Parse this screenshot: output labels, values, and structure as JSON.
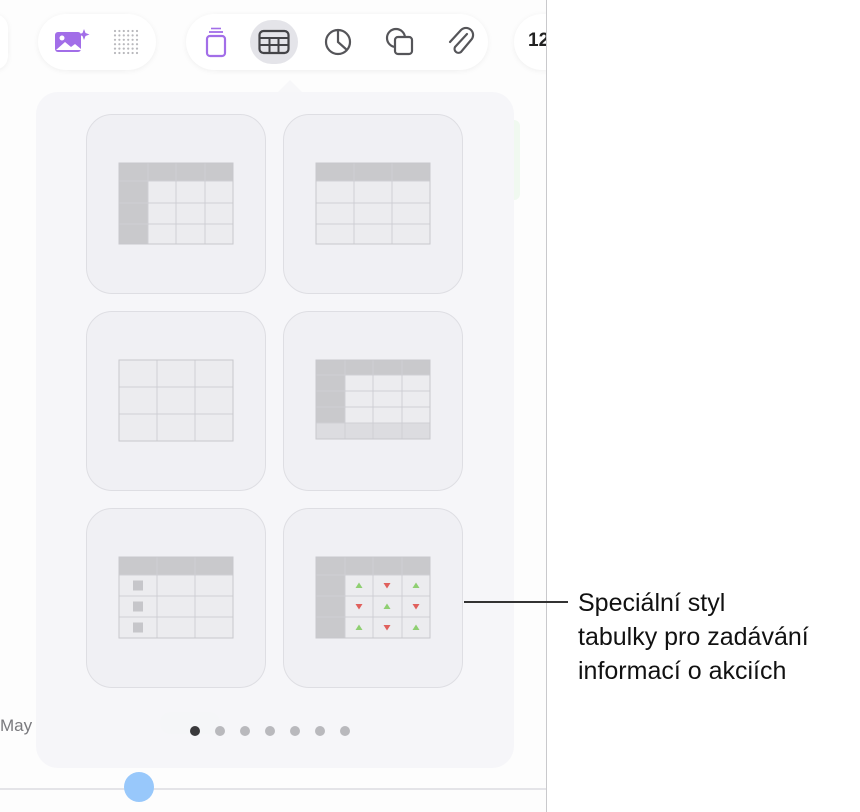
{
  "toolbar": {
    "buttons": [
      {
        "name": "media-button",
        "icon": "photo-sparkle-icon",
        "active": false
      },
      {
        "name": "grid-button",
        "icon": "dotted-grid-icon",
        "active": false
      },
      {
        "name": "text-box-button",
        "icon": "text-box-icon",
        "active": false
      },
      {
        "name": "table-button",
        "icon": "table-icon",
        "active": true
      },
      {
        "name": "chart-button",
        "icon": "pie-chart-icon",
        "active": false
      },
      {
        "name": "shape-button",
        "icon": "shape-icon",
        "active": false
      },
      {
        "name": "attachment-button",
        "icon": "paperclip-icon",
        "active": false
      }
    ],
    "partial_right_text": "12"
  },
  "table_styles": {
    "tiles": [
      {
        "style": "header-row-and-column"
      },
      {
        "style": "header-row"
      },
      {
        "style": "plain"
      },
      {
        "style": "header-row-column-footer"
      },
      {
        "style": "checklist"
      },
      {
        "style": "stock"
      }
    ]
  },
  "page_indicator": {
    "count": 7,
    "active_index": 0
  },
  "background": {
    "month_label": "May"
  },
  "callout": {
    "lines": [
      "Speciální styl",
      "tabulky pro zadávání",
      "informací o akciích"
    ]
  },
  "colors": {
    "accent_purple": "#a26ee8",
    "icon_gray": "#555559",
    "header_fill": "#c9c9cc",
    "cell_fill": "#ececef",
    "arrow_up": "#8fcf72",
    "arrow_down": "#e0605c",
    "scrubber_blue": "#98c8fb"
  }
}
